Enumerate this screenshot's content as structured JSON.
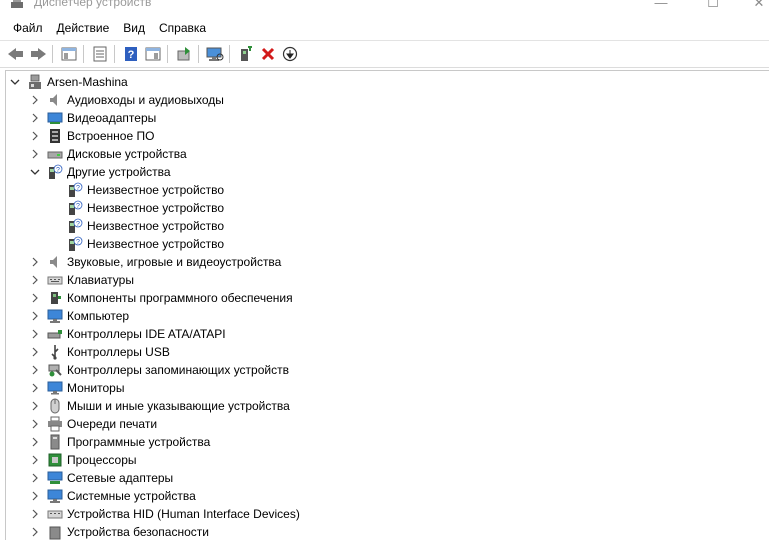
{
  "window": {
    "title": "Диспетчер устройств",
    "controls": [
      "—",
      "☐",
      "✕"
    ]
  },
  "menu": [
    "Файл",
    "Действие",
    "Вид",
    "Справка"
  ],
  "toolbar": [
    "back-icon",
    "forward-icon",
    "separator",
    "show-hide-console-tree-icon",
    "separator",
    "properties-icon",
    "separator",
    "help-icon",
    "action-pane-icon",
    "separator",
    "update-driver-icon",
    "separator",
    "scan-hardware-icon",
    "separator",
    "add-legacy-hardware-icon",
    "uninstall-device-icon",
    "disable-device-icon"
  ],
  "tree": {
    "root": "Arsen-Mashina",
    "categories": [
      {
        "label": "Аудиовходы и аудиовыходы",
        "icon": "speaker-icon",
        "expanded": false
      },
      {
        "label": "Видеоадаптеры",
        "icon": "display-adapter-icon",
        "expanded": false
      },
      {
        "label": "Встроенное ПО",
        "icon": "firmware-icon",
        "expanded": false
      },
      {
        "label": "Дисковые устройства",
        "icon": "disk-drive-icon",
        "expanded": false
      },
      {
        "label": "Другие устройства",
        "icon": "unknown-device-icon",
        "expanded": true,
        "children": [
          "Неизвестное устройство",
          "Неизвестное устройство",
          "Неизвестное устройство",
          "Неизвестное устройство"
        ]
      },
      {
        "label": "Звуковые, игровые и видеоустройства",
        "icon": "speaker-icon",
        "expanded": false
      },
      {
        "label": "Клавиатуры",
        "icon": "keyboard-icon",
        "expanded": false
      },
      {
        "label": "Компоненты программного обеспечения",
        "icon": "software-component-icon",
        "expanded": false
      },
      {
        "label": "Компьютер",
        "icon": "computer-icon",
        "expanded": false
      },
      {
        "label": "Контроллеры IDE ATA/ATAPI",
        "icon": "ide-controller-icon",
        "expanded": false
      },
      {
        "label": "Контроллеры USB",
        "icon": "usb-icon",
        "expanded": false
      },
      {
        "label": "Контроллеры запоминающих устройств",
        "icon": "storage-controller-icon",
        "expanded": false
      },
      {
        "label": "Мониторы",
        "icon": "monitor-icon",
        "expanded": false
      },
      {
        "label": "Мыши и иные указывающие устройства",
        "icon": "mouse-icon",
        "expanded": false
      },
      {
        "label": "Очереди печати",
        "icon": "printer-icon",
        "expanded": false
      },
      {
        "label": "Программные устройства",
        "icon": "software-device-icon",
        "expanded": false
      },
      {
        "label": "Процессоры",
        "icon": "processor-icon",
        "expanded": false
      },
      {
        "label": "Сетевые адаптеры",
        "icon": "network-adapter-icon",
        "expanded": false
      },
      {
        "label": "Системные устройства",
        "icon": "system-device-icon",
        "expanded": false
      },
      {
        "label": "Устройства HID (Human Interface Devices)",
        "icon": "hid-icon",
        "expanded": false
      },
      {
        "label": "Устройства безопасности",
        "icon": "security-device-icon",
        "expanded": false
      }
    ]
  },
  "colors": {
    "accent_blue": "#2e7fd6",
    "unknown_green": "#2f8f3a",
    "uninstall_red": "#d21a1a"
  }
}
